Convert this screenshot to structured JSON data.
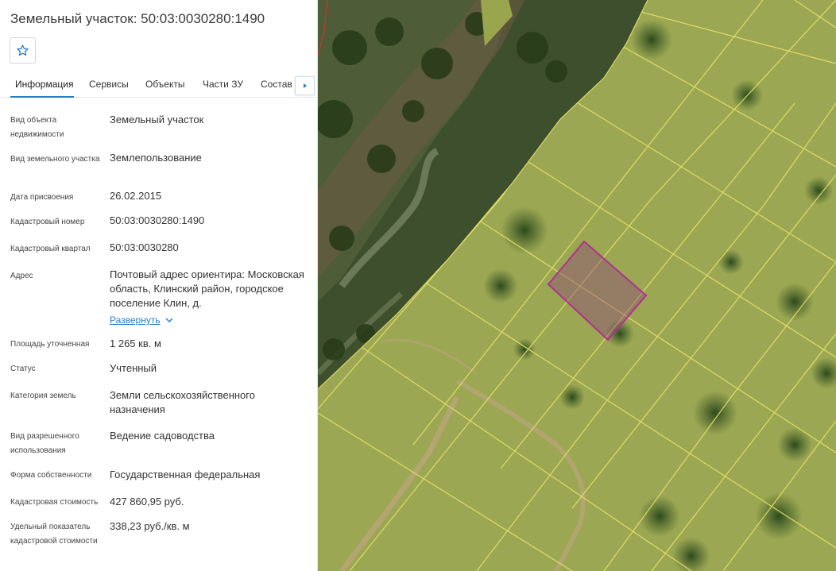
{
  "header": {
    "title": "Земельный участок: 50:03:0030280:1490"
  },
  "tabs": [
    {
      "label": "Информация",
      "active": true
    },
    {
      "label": "Сервисы",
      "active": false
    },
    {
      "label": "Объекты",
      "active": false
    },
    {
      "label": "Части ЗУ",
      "active": false
    },
    {
      "label": "Состав ЕЗП",
      "active": false
    }
  ],
  "info": [
    {
      "label": "Вид объекта недвижимости",
      "value": "Земельный участок"
    },
    {
      "label": "Вид земельного участка",
      "value": "Землепользование"
    },
    {
      "label": "Дата присвоения",
      "value": "26.02.2015"
    },
    {
      "label": "Кадастровый номер",
      "value": "50:03:0030280:1490"
    },
    {
      "label": "Кадастровый квартал",
      "value": "50:03:0030280"
    },
    {
      "label": "Адрес",
      "value": "Почтовый адрес ориентира: Московская область, Клинский район, городское поселение Клин, д."
    },
    {
      "label": "Площадь уточненная",
      "value": "1 265 кв. м"
    },
    {
      "label": "Статус",
      "value": "Учтенный"
    },
    {
      "label": "Категория земель",
      "value": "Земли сельскохозяйственного назначения"
    },
    {
      "label": "Вид разрешенного использования",
      "value": "Ведение садоводства"
    },
    {
      "label": "Форма собственности",
      "value": "Государственная федеральная"
    },
    {
      "label": "Кадастровая стоимость",
      "value": "427 860,95 руб."
    },
    {
      "label": "Удельный показатель кадастровой стоимости",
      "value": "338,23 руб./кв. м"
    }
  ],
  "address_expand": "Развернуть",
  "icons": {
    "favorite": "star-outline-icon",
    "tabs_scroll": "caret-right-icon",
    "expand": "chevron-down-icon"
  },
  "colors": {
    "accent": "#2b7dc5",
    "parcel_border": "#b0318f",
    "cadastral_lines": "#e8e26a"
  }
}
